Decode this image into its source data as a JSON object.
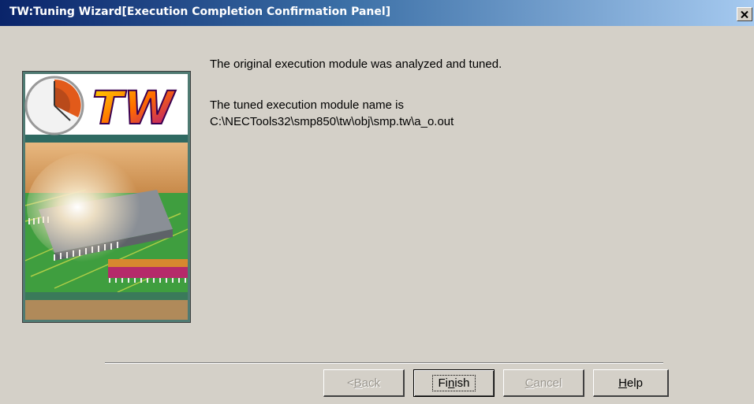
{
  "window": {
    "title": "TW:Tuning Wizard[Execution Completion Confirmation Panel]"
  },
  "panel_image": {
    "logo_text": "TW"
  },
  "message": {
    "line1": "The original execution module was analyzed and tuned.",
    "line2": "The tuned execution module name is",
    "line3": "C:\\NECTools32\\smp850\\tw\\obj\\smp.tw\\a_o.out"
  },
  "buttons": {
    "back": {
      "prefix": "< ",
      "mnemonic": "B",
      "rest": "ack"
    },
    "finish": {
      "pre": "Fi",
      "mnemonic": "n",
      "rest": "ish"
    },
    "cancel": {
      "mnemonic": "C",
      "rest": "ancel"
    },
    "help": {
      "mnemonic": "H",
      "rest": "elp"
    }
  },
  "colors": {
    "title_gradient_start": "#0a246a",
    "title_gradient_end": "#a6caf0",
    "dialog_bg": "#d4d0c8"
  }
}
